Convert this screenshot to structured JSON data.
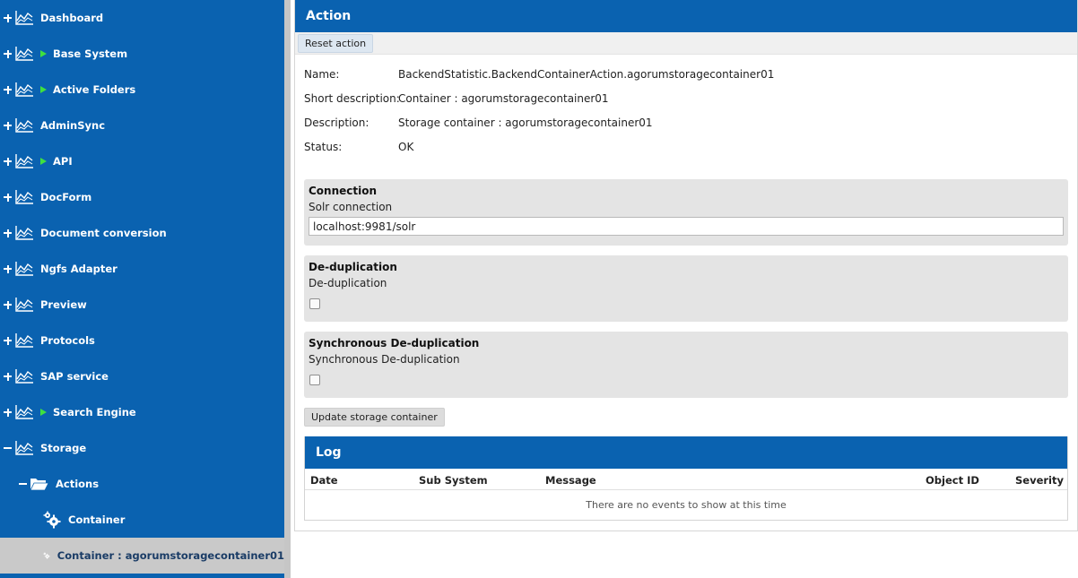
{
  "sidebar": {
    "items": [
      {
        "label": "Dashboard",
        "expander": "plus",
        "arrow": false
      },
      {
        "label": "Base System",
        "expander": "plus",
        "arrow": true
      },
      {
        "label": "Active Folders",
        "expander": "plus",
        "arrow": true
      },
      {
        "label": "AdminSync",
        "expander": "plus",
        "arrow": false
      },
      {
        "label": "API",
        "expander": "plus",
        "arrow": true
      },
      {
        "label": "DocForm",
        "expander": "plus",
        "arrow": false
      },
      {
        "label": "Document conversion",
        "expander": "plus",
        "arrow": false
      },
      {
        "label": "Ngfs Adapter",
        "expander": "plus",
        "arrow": false
      },
      {
        "label": "Preview",
        "expander": "plus",
        "arrow": false
      },
      {
        "label": "Protocols",
        "expander": "plus",
        "arrow": false
      },
      {
        "label": "SAP service",
        "expander": "plus",
        "arrow": false
      },
      {
        "label": "Search Engine",
        "expander": "plus",
        "arrow": true
      },
      {
        "label": "Storage",
        "expander": "minus",
        "arrow": false
      }
    ],
    "actions_label": "Actions",
    "container_label": "Container",
    "selected_label": "Container : agorumstoragecontainer01"
  },
  "action": {
    "title": "Action",
    "reset_label": "Reset action",
    "props": {
      "name_key": "Name:",
      "name_value": "BackendStatistic.BackendContainerAction.agorumstoragecontainer01",
      "short_key": "Short description:",
      "short_value": "Container : agorumstoragecontainer01",
      "desc_key": "Description:",
      "desc_value": "Storage container : agorumstoragecontainer01",
      "status_key": "Status:",
      "status_value": "OK"
    },
    "connection": {
      "title": "Connection",
      "field_label": "Solr connection",
      "value": "localhost:9981/solr"
    },
    "dedup": {
      "title": "De-duplication",
      "field_label": "De-duplication",
      "checked": false
    },
    "sync_dedup": {
      "title": "Synchronous De-duplication",
      "field_label": "Synchronous De-duplication",
      "checked": false
    },
    "update_label": "Update storage container"
  },
  "log": {
    "title": "Log",
    "columns": [
      "Date",
      "Sub System",
      "Message",
      "Object ID",
      "Severity"
    ],
    "empty_text": "There are no events to show at this time"
  },
  "colors": {
    "primary": "#0a62b0",
    "selected_bg": "#c9c9c9",
    "arrow": "#3fe03f"
  }
}
